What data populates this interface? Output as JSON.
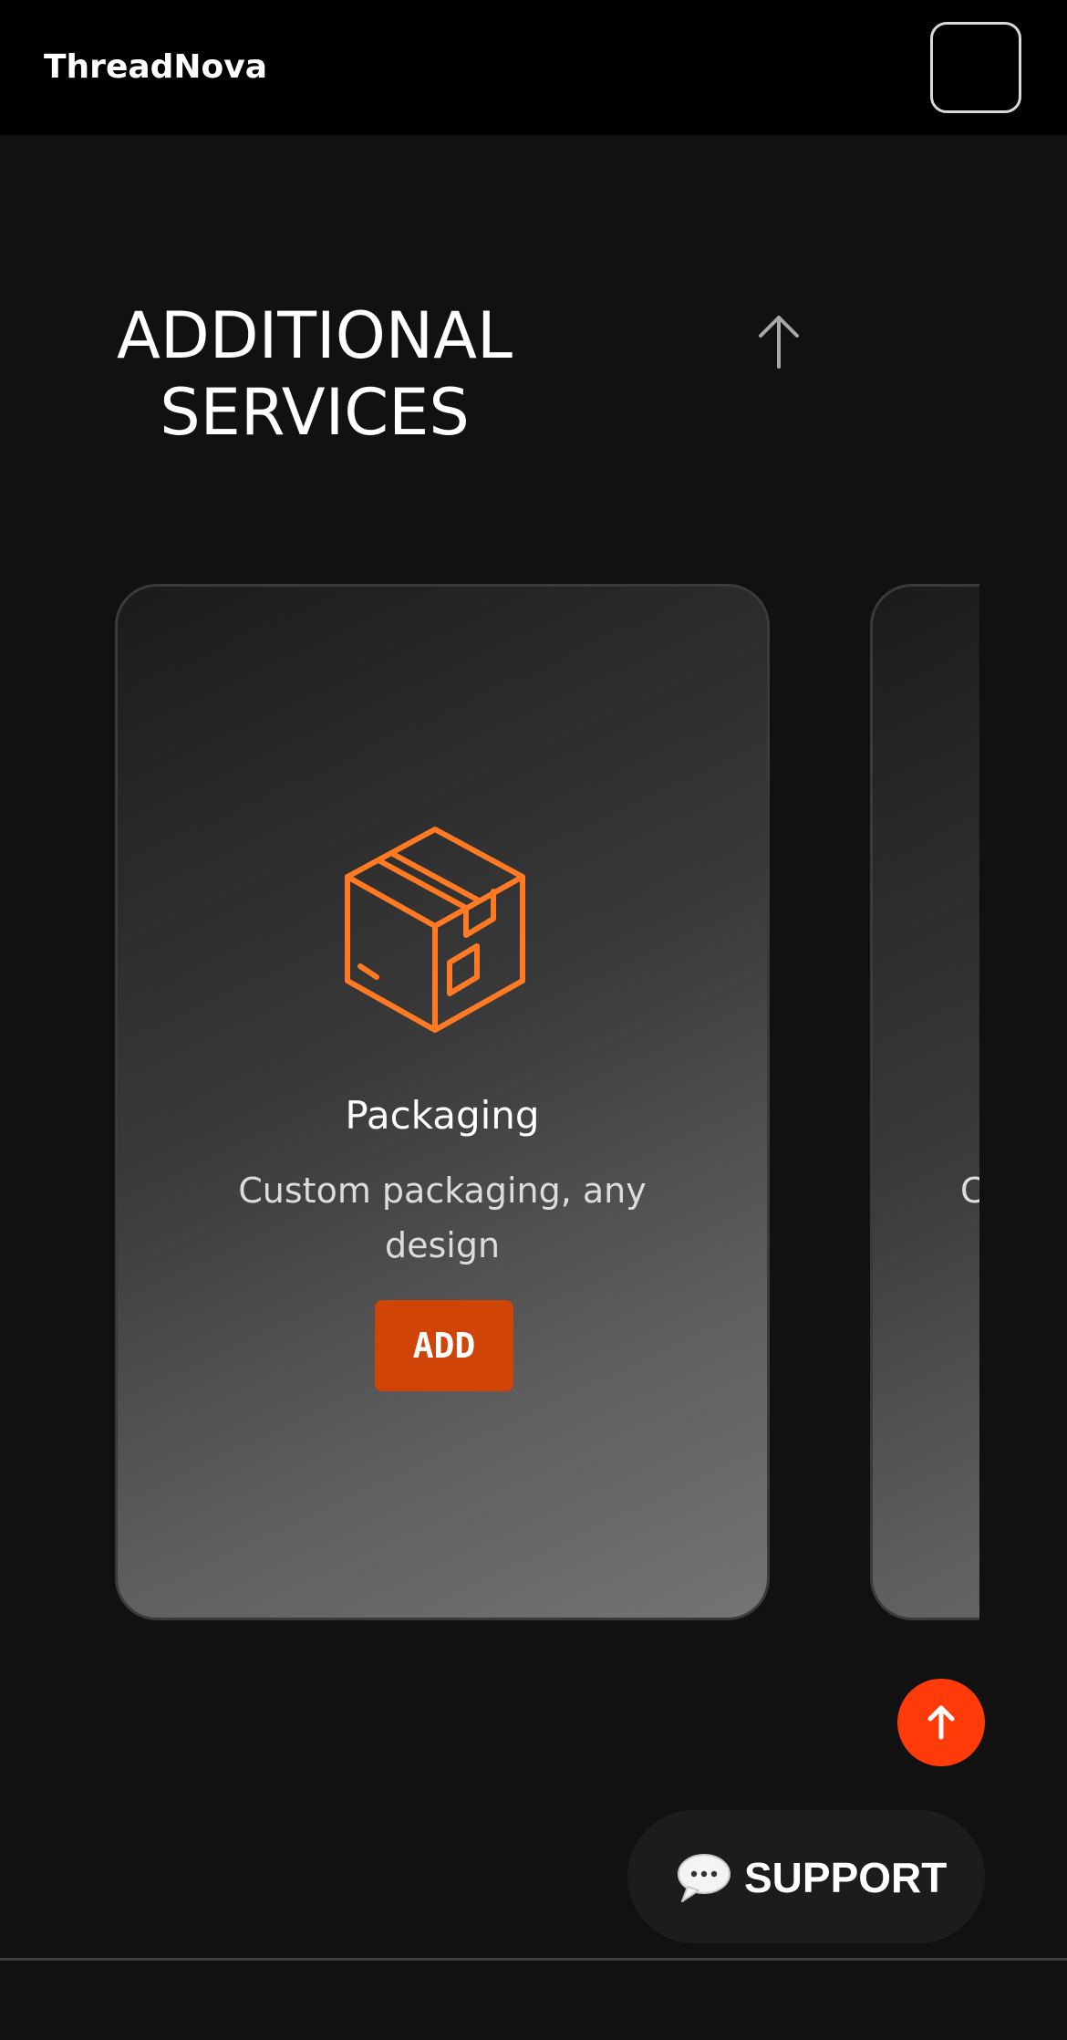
{
  "header": {
    "brand": "ThreadNova",
    "menu_icon": "menu-button"
  },
  "section": {
    "title_line1": "ADDITIONAL",
    "title_line2": "SERVICES",
    "collapse_icon": "arrow-up-icon"
  },
  "cards": [
    {
      "icon": "package-box-icon",
      "title": "Packaging",
      "description": "Custom packaging, any design",
      "button_label": "ADD"
    },
    {
      "visible_text": "C"
    }
  ],
  "fab": {
    "scroll_top_icon": "arrow-up-icon"
  },
  "support": {
    "icon": "speech-bubble-icon",
    "label": "SUPPORT"
  },
  "colors": {
    "accent": "#ff3b0a",
    "button": "#d14408",
    "icon_orange": "#ff7a22",
    "background": "#111111",
    "header": "#000000"
  }
}
